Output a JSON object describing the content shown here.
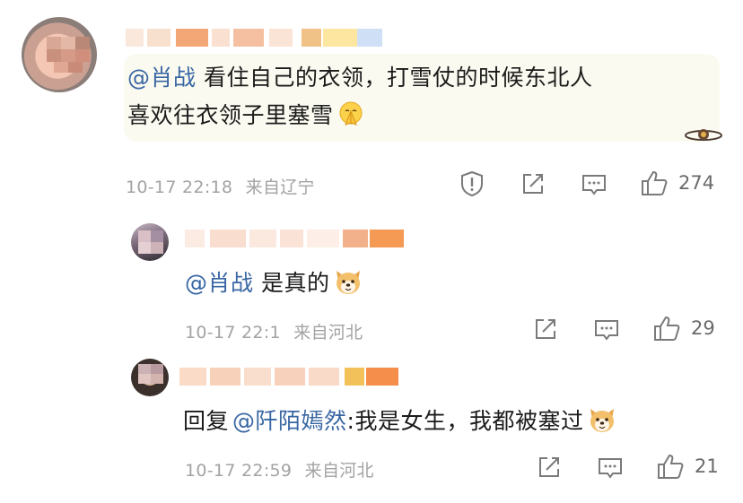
{
  "comments": [
    {
      "mention": "@肖战",
      "text_line1": " 看住自己的衣领，打雪仗的时候东北人",
      "text_line2": "喜欢往衣领子里塞雪",
      "emoji": "praying-face-emoji",
      "time": "10-17 22:18",
      "location": "来自辽宁",
      "likes": "274",
      "icons": [
        "report-icon",
        "share-icon",
        "comment-icon",
        "thumbs-up-icon"
      ]
    }
  ],
  "replies": [
    {
      "mention": "@肖战",
      "text": " 是真的",
      "emoji": "dog-face-emoji",
      "time": "10-17 22:1",
      "location": "来自河北",
      "likes": "29",
      "icons": [
        "share-icon",
        "comment-icon",
        "thumbs-up-icon"
      ]
    },
    {
      "prefix": "回复",
      "mention": "@阡陌嫣然",
      "text": ":我是女生，我都被塞过",
      "emoji": "dog-face-emoji",
      "time": "10-17 22:59",
      "location": "来自河北",
      "likes": "21",
      "icons": [
        "share-icon",
        "comment-icon",
        "thumbs-up-icon"
      ]
    }
  ],
  "colors": {
    "mention": "#3866a3",
    "bubble": "#fbfaf0",
    "meta": "#a3a3a3",
    "icon": "#7a7a7a"
  }
}
